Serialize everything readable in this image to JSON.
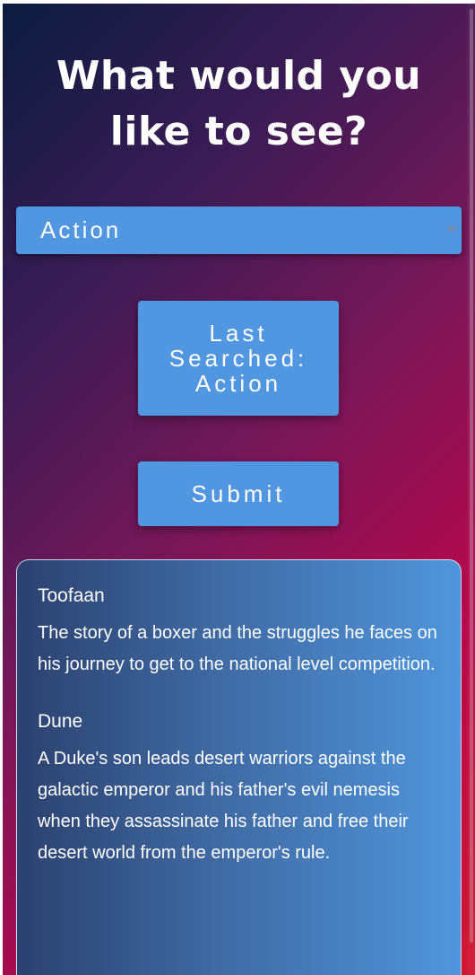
{
  "header": {
    "title_line1": "What would you",
    "title_line2": "like to see?"
  },
  "genre_select": {
    "selected": "Action"
  },
  "last_searched": {
    "line1": "Last",
    "line2": "Searched:",
    "line3": "Action"
  },
  "submit_label": "Submit",
  "results": [
    {
      "title": "Toofaan",
      "description": "The story of a boxer and the struggles he faces on his journey to get to the national level competition."
    },
    {
      "title": "Dune",
      "description": "A Duke's son leads desert warriors against the galactic emperor and his father's evil nemesis when they assassinate his father and free their desert world from the emperor's rule."
    }
  ],
  "colors": {
    "button_bg": "#5096e0",
    "gradient_start": "#0b1c3f",
    "gradient_end": "#d21730"
  }
}
